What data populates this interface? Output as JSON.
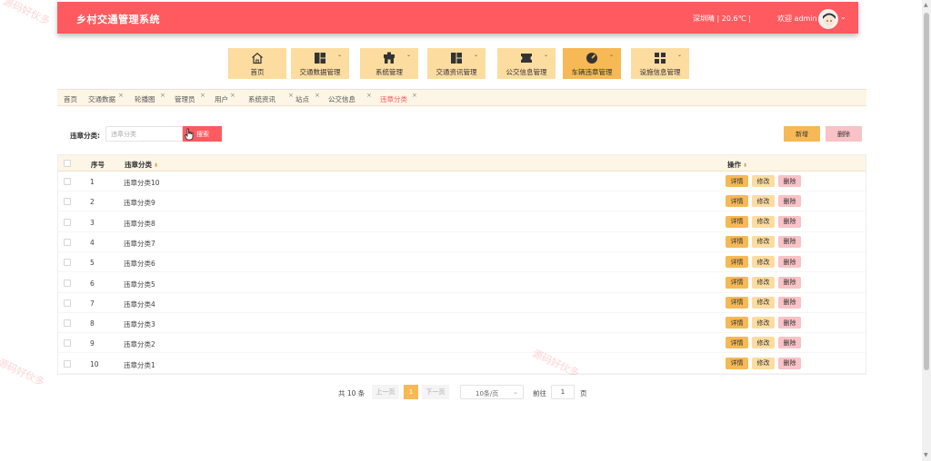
{
  "header": {
    "title": "乡村交通管理系统",
    "weather": "深圳晴 | 20.6℃  |",
    "welcome": "欢迎 admin",
    "accent": "#ff5a5f"
  },
  "nav": [
    {
      "label": "首页",
      "icon": "home-icon",
      "active": false,
      "has_menu": false
    },
    {
      "label": "交通数据管理",
      "icon": "grid-icon",
      "active": false,
      "has_menu": true
    },
    {
      "label": "系统管理",
      "icon": "shop-icon",
      "active": false,
      "has_menu": true
    },
    {
      "label": "交通资讯管理",
      "icon": "grid-icon",
      "active": false,
      "has_menu": true
    },
    {
      "label": "公交信息管理",
      "icon": "ticket-icon",
      "active": false,
      "has_menu": true
    },
    {
      "label": "车辆违章管理",
      "icon": "gauge-icon",
      "active": true,
      "has_menu": true
    },
    {
      "label": "设施信息管理",
      "icon": "apps-icon",
      "active": false,
      "has_menu": true
    }
  ],
  "tabs": [
    {
      "label": "首页",
      "closable": false
    },
    {
      "label": "交通数据",
      "closable": true
    },
    {
      "label": "轮播图",
      "closable": true
    },
    {
      "label": "管理员",
      "closable": true
    },
    {
      "label": "用户",
      "closable": true
    },
    {
      "label": "系统资讯",
      "closable": true
    },
    {
      "label": "站点",
      "closable": true
    },
    {
      "label": "公交信息",
      "closable": true
    },
    {
      "label": "违章分类",
      "closable": true,
      "active": true
    }
  ],
  "search": {
    "label": "违章分类:",
    "placeholder": "违章分类",
    "button": "搜索"
  },
  "actions": {
    "add": "新增",
    "delete": "删除"
  },
  "table": {
    "columns": {
      "index": "序号",
      "category": "违章分类",
      "ops": "操作"
    },
    "op_labels": {
      "detail": "详情",
      "edit": "修改",
      "delete": "删除"
    },
    "rows": [
      {
        "index": "1",
        "category": "违章分类10"
      },
      {
        "index": "2",
        "category": "违章分类9"
      },
      {
        "index": "3",
        "category": "违章分类8"
      },
      {
        "index": "4",
        "category": "违章分类7"
      },
      {
        "index": "5",
        "category": "违章分类6"
      },
      {
        "index": "6",
        "category": "违章分类5"
      },
      {
        "index": "7",
        "category": "违章分类4"
      },
      {
        "index": "8",
        "category": "违章分类3"
      },
      {
        "index": "9",
        "category": "违章分类2"
      },
      {
        "index": "10",
        "category": "违章分类1"
      }
    ]
  },
  "pagination": {
    "total": "共 10 条",
    "prev": "上一页",
    "current": "1",
    "next": "下一页",
    "page_size": "10条/页",
    "goto": "前往",
    "goto_value": "1",
    "goto_unit": "页"
  },
  "watermarks": [
    "源码好伙多",
    "源码好伙多",
    "源码好伙多"
  ]
}
